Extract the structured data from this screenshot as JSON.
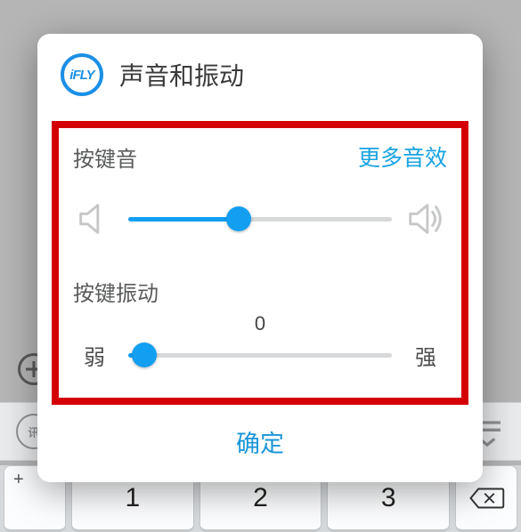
{
  "dialog": {
    "logo_text": "iFLY",
    "title": "声音和振动",
    "keysound": {
      "label": "按键音",
      "more": "更多音效",
      "slider_percent": 42
    },
    "vibration": {
      "label": "按键振动",
      "value_label": "0",
      "min_label": "弱",
      "max_label": "强",
      "slider_percent": 6
    },
    "confirm": "确定"
  },
  "keyboard": {
    "plus_sup": "+",
    "k1": "1",
    "k2": "2",
    "k3": "3",
    "icon_badge": "讯"
  }
}
